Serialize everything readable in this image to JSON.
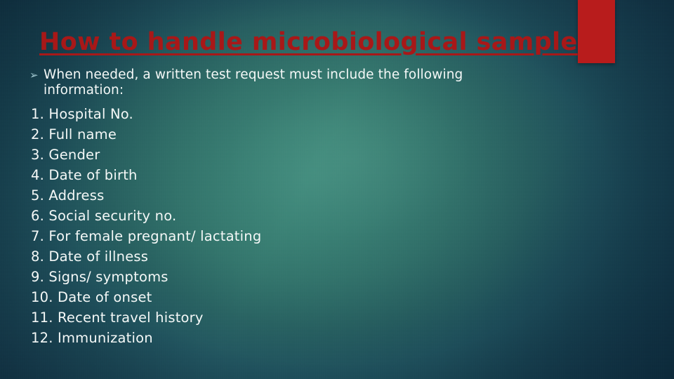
{
  "slide": {
    "title": "How to handle microbiological sample",
    "title_color": "#A81818",
    "background_center_color": "#3F8A7C",
    "background_edge_color": "#1A4253"
  },
  "accent": {
    "color": "#B81C1C",
    "name": "red-accent-block"
  },
  "bullet": {
    "glyph": "➢",
    "glyph_name": "chevron-bullet-icon",
    "text": "When needed, a written test request must include the following information:"
  },
  "list": {
    "items": [
      "1. Hospital No.",
      "2. Full name",
      "3. Gender",
      "4. Date of birth",
      "5. Address",
      "6. Social security no.",
      "7. For female pregnant/ lactating",
      "8. Date of illness",
      "9. Signs/ symptoms",
      "10. Date of onset",
      "11. Recent travel history",
      "12. Immunization"
    ]
  }
}
